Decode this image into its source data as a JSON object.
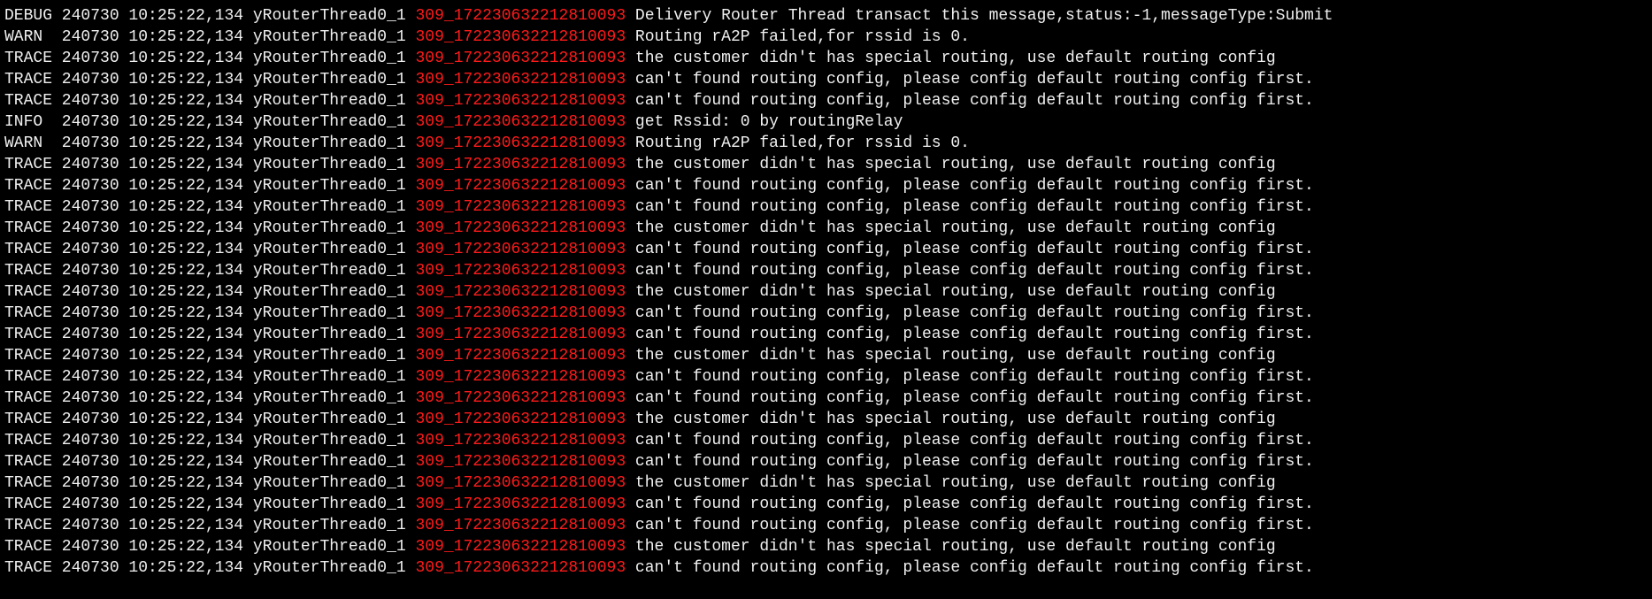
{
  "colors": {
    "background": "#000000",
    "text": "#f0f0f0",
    "message_id": "#ff1a1a"
  },
  "log_lines": [
    {
      "prefix": "DEBUG 240730 10:25:22,134 yRouterThread0_1 ",
      "id": "309_172230632212810093",
      "message": " Delivery Router Thread transact this message,status:-1,messageType:Submit"
    },
    {
      "prefix": "WARN  240730 10:25:22,134 yRouterThread0_1 ",
      "id": "309_172230632212810093",
      "message": " Routing rA2P failed,for rssid is 0."
    },
    {
      "prefix": "TRACE 240730 10:25:22,134 yRouterThread0_1 ",
      "id": "309_172230632212810093",
      "message": " the customer didn't has special routing, use default routing config"
    },
    {
      "prefix": "TRACE 240730 10:25:22,134 yRouterThread0_1 ",
      "id": "309_172230632212810093",
      "message": " can't found routing config, please config default routing config first."
    },
    {
      "prefix": "TRACE 240730 10:25:22,134 yRouterThread0_1 ",
      "id": "309_172230632212810093",
      "message": " can't found routing config, please config default routing config first."
    },
    {
      "prefix": "INFO  240730 10:25:22,134 yRouterThread0_1 ",
      "id": "309_172230632212810093",
      "message": " get Rssid: 0 by routingRelay"
    },
    {
      "prefix": "WARN  240730 10:25:22,134 yRouterThread0_1 ",
      "id": "309_172230632212810093",
      "message": " Routing rA2P failed,for rssid is 0."
    },
    {
      "prefix": "TRACE 240730 10:25:22,134 yRouterThread0_1 ",
      "id": "309_172230632212810093",
      "message": " the customer didn't has special routing, use default routing config"
    },
    {
      "prefix": "TRACE 240730 10:25:22,134 yRouterThread0_1 ",
      "id": "309_172230632212810093",
      "message": " can't found routing config, please config default routing config first."
    },
    {
      "prefix": "TRACE 240730 10:25:22,134 yRouterThread0_1 ",
      "id": "309_172230632212810093",
      "message": " can't found routing config, please config default routing config first."
    },
    {
      "prefix": "TRACE 240730 10:25:22,134 yRouterThread0_1 ",
      "id": "309_172230632212810093",
      "message": " the customer didn't has special routing, use default routing config"
    },
    {
      "prefix": "TRACE 240730 10:25:22,134 yRouterThread0_1 ",
      "id": "309_172230632212810093",
      "message": " can't found routing config, please config default routing config first."
    },
    {
      "prefix": "TRACE 240730 10:25:22,134 yRouterThread0_1 ",
      "id": "309_172230632212810093",
      "message": " can't found routing config, please config default routing config first."
    },
    {
      "prefix": "TRACE 240730 10:25:22,134 yRouterThread0_1 ",
      "id": "309_172230632212810093",
      "message": " the customer didn't has special routing, use default routing config"
    },
    {
      "prefix": "TRACE 240730 10:25:22,134 yRouterThread0_1 ",
      "id": "309_172230632212810093",
      "message": " can't found routing config, please config default routing config first."
    },
    {
      "prefix": "TRACE 240730 10:25:22,134 yRouterThread0_1 ",
      "id": "309_172230632212810093",
      "message": " can't found routing config, please config default routing config first."
    },
    {
      "prefix": "TRACE 240730 10:25:22,134 yRouterThread0_1 ",
      "id": "309_172230632212810093",
      "message": " the customer didn't has special routing, use default routing config"
    },
    {
      "prefix": "TRACE 240730 10:25:22,134 yRouterThread0_1 ",
      "id": "309_172230632212810093",
      "message": " can't found routing config, please config default routing config first."
    },
    {
      "prefix": "TRACE 240730 10:25:22,134 yRouterThread0_1 ",
      "id": "309_172230632212810093",
      "message": " can't found routing config, please config default routing config first."
    },
    {
      "prefix": "TRACE 240730 10:25:22,134 yRouterThread0_1 ",
      "id": "309_172230632212810093",
      "message": " the customer didn't has special routing, use default routing config"
    },
    {
      "prefix": "TRACE 240730 10:25:22,134 yRouterThread0_1 ",
      "id": "309_172230632212810093",
      "message": " can't found routing config, please config default routing config first."
    },
    {
      "prefix": "TRACE 240730 10:25:22,134 yRouterThread0_1 ",
      "id": "309_172230632212810093",
      "message": " can't found routing config, please config default routing config first."
    },
    {
      "prefix": "TRACE 240730 10:25:22,134 yRouterThread0_1 ",
      "id": "309_172230632212810093",
      "message": " the customer didn't has special routing, use default routing config"
    },
    {
      "prefix": "TRACE 240730 10:25:22,134 yRouterThread0_1 ",
      "id": "309_172230632212810093",
      "message": " can't found routing config, please config default routing config first."
    },
    {
      "prefix": "TRACE 240730 10:25:22,134 yRouterThread0_1 ",
      "id": "309_172230632212810093",
      "message": " can't found routing config, please config default routing config first."
    },
    {
      "prefix": "TRACE 240730 10:25:22,134 yRouterThread0_1 ",
      "id": "309_172230632212810093",
      "message": " the customer didn't has special routing, use default routing config"
    },
    {
      "prefix": "TRACE 240730 10:25:22,134 yRouterThread0_1 ",
      "id": "309_172230632212810093",
      "message": " can't found routing config, please config default routing config first."
    }
  ]
}
